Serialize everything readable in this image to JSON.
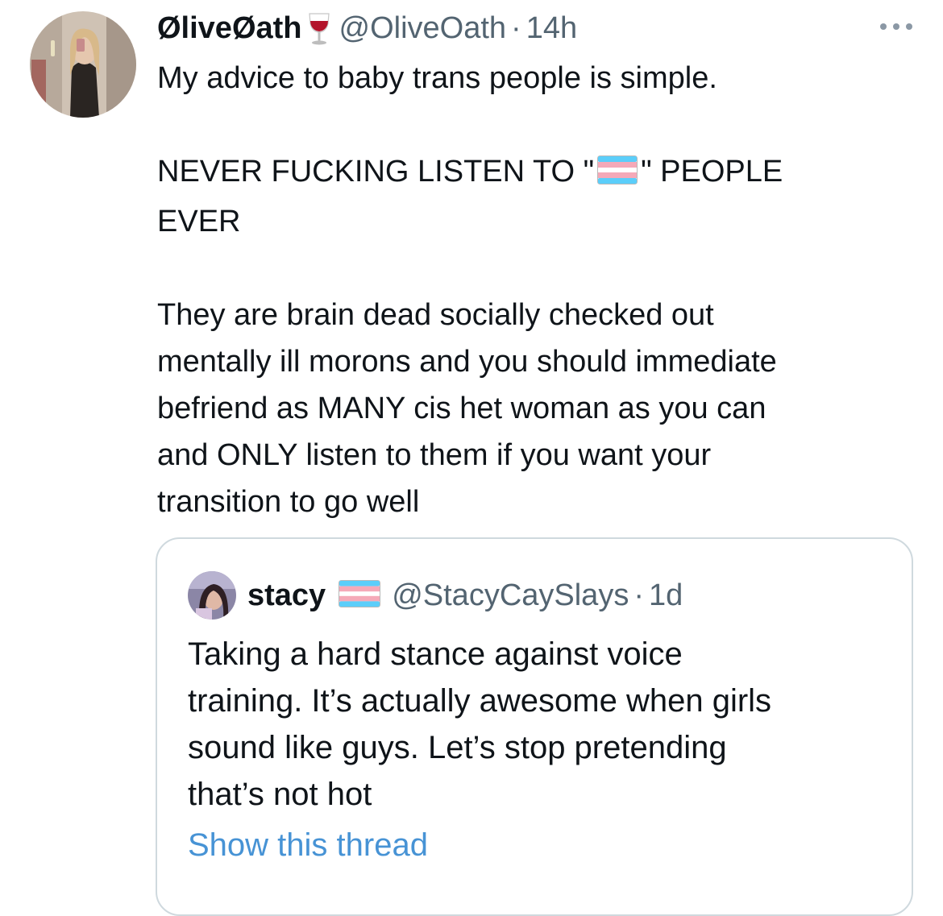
{
  "tweet": {
    "display_name": "ØliveØath",
    "name_emoji": "wine-glass-icon",
    "handle": "@OliveOath",
    "separator": "·",
    "time": "14h",
    "text_lines": [
      "My advice to baby trans people is simple.",
      "",
      "NEVER FUCKING LISTEN TO \"",
      "\" PEOPLE",
      "EVER",
      "",
      "They are brain dead socially checked out",
      "mentally ill morons and you should immediate",
      "befriend as MANY cis het woman as you can",
      "and ONLY listen to them if you want your",
      "transition to go well"
    ],
    "inline_emoji": "trans-flag-icon"
  },
  "quote": {
    "display_name": "stacy",
    "name_emoji": "trans-flag-icon",
    "handle": "@StacyCaySlays",
    "separator": "·",
    "time": "1d",
    "text_lines": [
      "Taking a hard stance against voice",
      "training. It’s actually awesome when girls",
      "sound like guys. Let’s stop pretending",
      "that’s not hot"
    ],
    "show_thread_label": "Show this thread"
  },
  "colors": {
    "text_primary": "#0f1419",
    "text_secondary": "#536471",
    "link": "#4793d5",
    "card_border": "#cfd9de",
    "trans_blue": "#5bcefa",
    "trans_pink": "#f5a9b8",
    "trans_white": "#ffffff"
  }
}
